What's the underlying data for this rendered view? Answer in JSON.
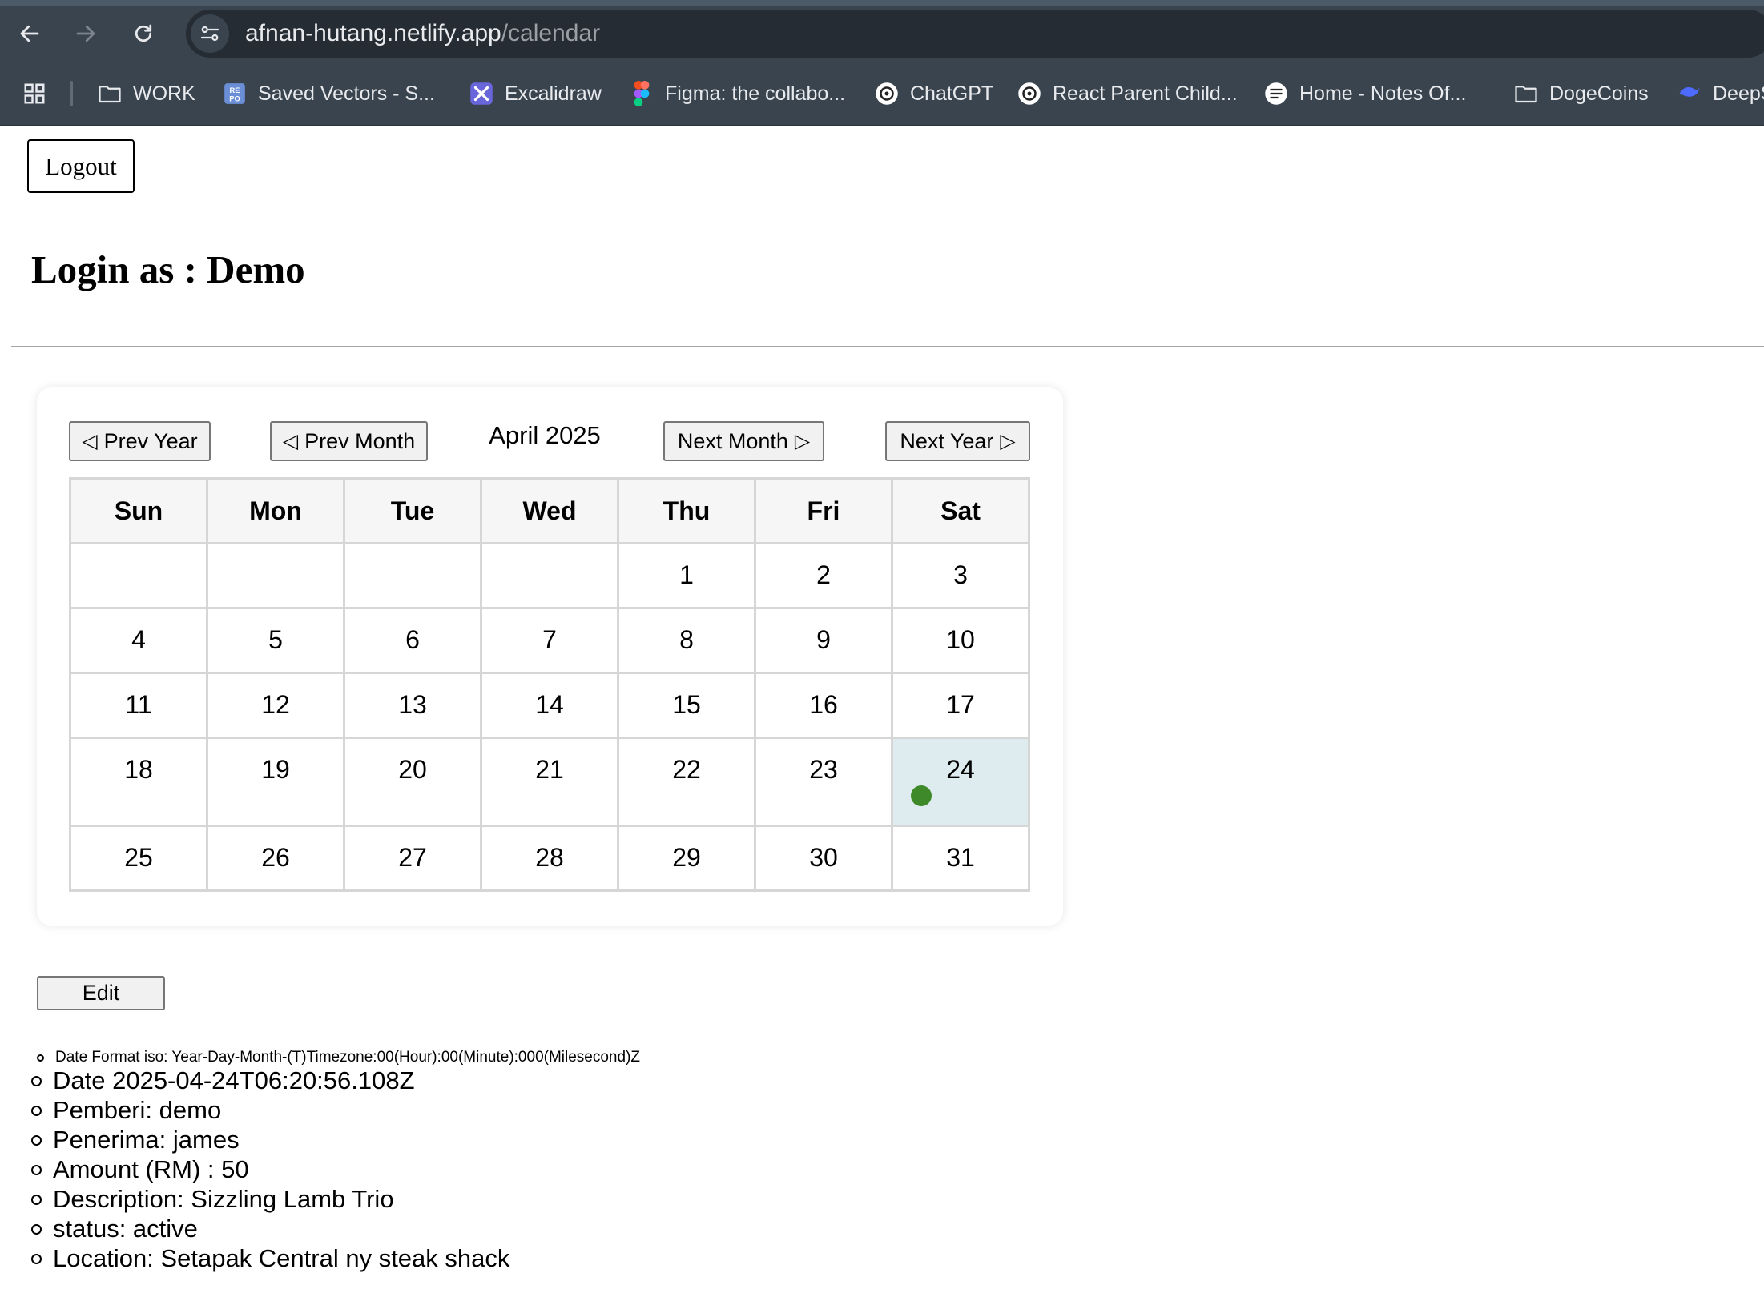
{
  "browser": {
    "url_host": "afnan-hutang.netlify.app",
    "url_path": "/calendar",
    "bookmarks": [
      {
        "label": "WORK",
        "icon": "folder-icon"
      },
      {
        "label": "Saved Vectors - S...",
        "icon": "repo-icon"
      },
      {
        "label": "Excalidraw",
        "icon": "excalidraw-icon"
      },
      {
        "label": "Figma: the collabo...",
        "icon": "figma-icon"
      },
      {
        "label": "ChatGPT",
        "icon": "chatgpt-icon"
      },
      {
        "label": "React Parent Child...",
        "icon": "chatgpt-icon"
      },
      {
        "label": "Home - Notes Of...",
        "icon": "notes-icon"
      },
      {
        "label": "DogeCoins",
        "icon": "folder-icon"
      },
      {
        "label": "DeepS",
        "icon": "deepseek-icon"
      }
    ]
  },
  "page": {
    "logout_label": "Logout",
    "login_title": "Login as : Demo"
  },
  "calendar": {
    "prev_year_label": "Prev Year",
    "prev_month_label": "Prev Month",
    "month_title": "April 2025",
    "next_month_label": "Next Month",
    "next_year_label": "Next Year",
    "weekdays": [
      "Sun",
      "Mon",
      "Tue",
      "Wed",
      "Thu",
      "Fri",
      "Sat"
    ],
    "weeks": [
      [
        "",
        "",
        "",
        "",
        "1",
        "2",
        "3"
      ],
      [
        "4",
        "5",
        "6",
        "7",
        "8",
        "9",
        "10"
      ],
      [
        "11",
        "12",
        "13",
        "14",
        "15",
        "16",
        "17"
      ],
      [
        "18",
        "19",
        "20",
        "21",
        "22",
        "23",
        "24"
      ],
      [
        "25",
        "26",
        "27",
        "28",
        "29",
        "30",
        "31"
      ]
    ],
    "selected_day": "24",
    "event_dot_color": "#3e8a2b",
    "selected_bg_color": "#deecef"
  },
  "edit_label": "Edit",
  "details": {
    "format_note": "Date Format iso: Year-Day-Month-(T)Timezone:00(Hour):00(Minute):000(Milesecond)Z",
    "items": [
      "Date 2025-04-24T06:20:56.108Z",
      "Pemberi: demo",
      "Penerima: james",
      "Amount (RM) : 50",
      "Description: Sizzling Lamb Trio",
      "status: active",
      "Location: Setapak Central ny steak shack"
    ]
  }
}
